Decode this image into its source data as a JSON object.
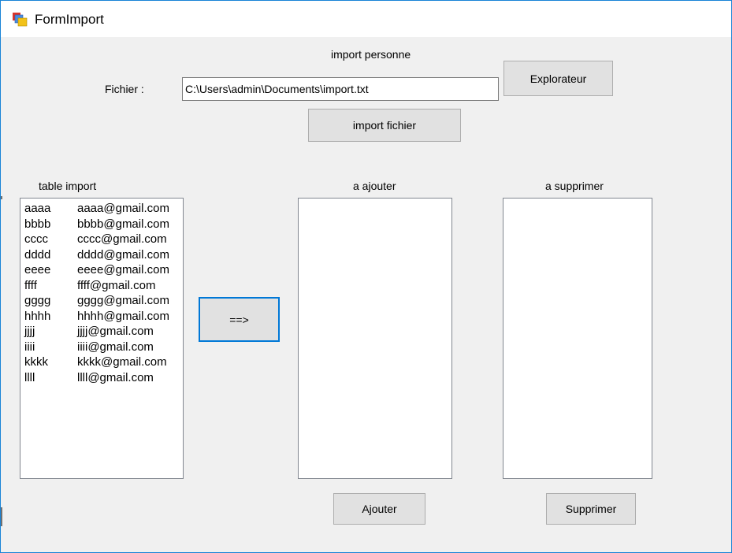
{
  "window": {
    "title": "FormImport",
    "icon": "winforms-app-icon"
  },
  "form": {
    "header_label": "import personne",
    "file_label": "Fichier :",
    "file_path": "C:\\Users\\admin\\Documents\\import.txt",
    "browse_button": "Explorateur",
    "import_button": "import fichier"
  },
  "table_import": {
    "label": "table import",
    "rows": [
      {
        "name": "aaaa",
        "email": "aaaa@gmail.com"
      },
      {
        "name": "bbbb",
        "email": "bbbb@gmail.com"
      },
      {
        "name": "cccc",
        "email": "cccc@gmail.com"
      },
      {
        "name": "dddd",
        "email": "dddd@gmail.com"
      },
      {
        "name": "eeee",
        "email": "eeee@gmail.com"
      },
      {
        "name": "ffff",
        "email": "ffff@gmail.com"
      },
      {
        "name": "gggg",
        "email": "gggg@gmail.com"
      },
      {
        "name": "hhhh",
        "email": "hhhh@gmail.com"
      },
      {
        "name": "jjjj",
        "email": "jjjj@gmail.com"
      },
      {
        "name": "iiii",
        "email": "iiii@gmail.com"
      },
      {
        "name": "kkkk",
        "email": "kkkk@gmail.com"
      },
      {
        "name": "llll",
        "email": "llll@gmail.com"
      }
    ]
  },
  "transfer_button": "==>",
  "a_ajouter": {
    "label": "a ajouter",
    "button": "Ajouter"
  },
  "a_supprimer": {
    "label": "a supprimer",
    "button": "Supprimer"
  },
  "colors": {
    "window_border": "#1883d7",
    "client_bg": "#f0f0f0",
    "button_bg": "#e1e1e1",
    "focus_border": "#0078d7"
  }
}
